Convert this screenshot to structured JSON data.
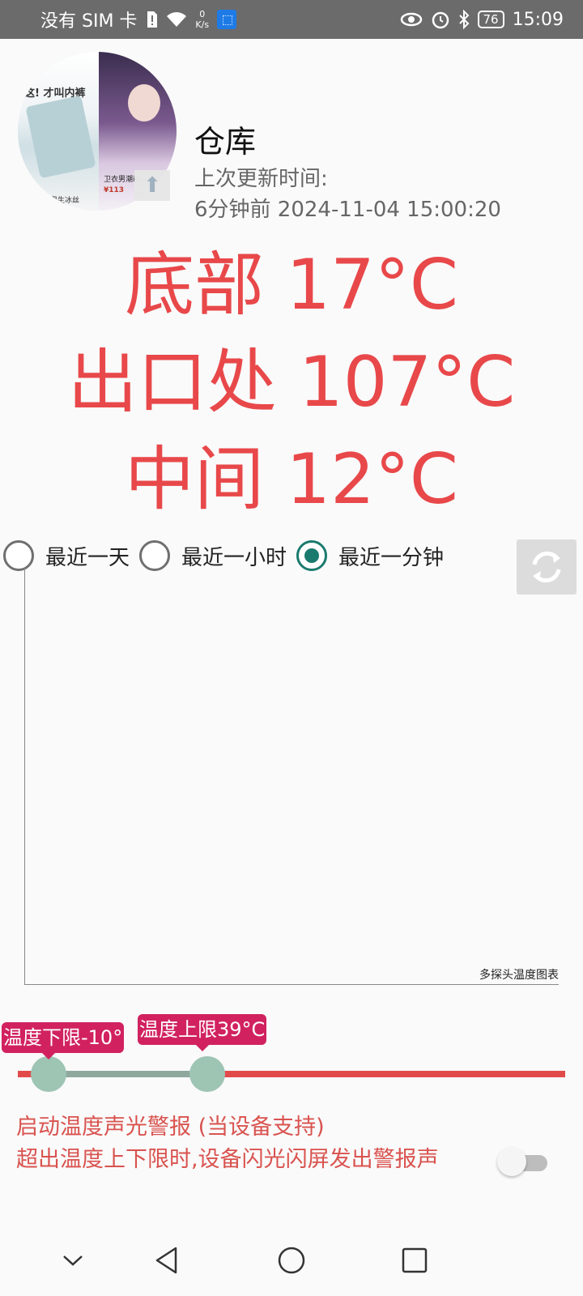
{
  "status_bar": {
    "carrier": "没有 SIM 卡",
    "speed_value": "0",
    "speed_unit": "K/s",
    "battery": "76",
    "time": "15:09",
    "icons": [
      "sim-alert-icon",
      "wifi-icon",
      "app-notification-icon",
      "eye-icon",
      "alarm-icon",
      "bluetooth-icon",
      "battery-icon"
    ]
  },
  "header": {
    "thumbnail": {
      "left_caption": "这! 才叫内裤",
      "left_footer": "男生冰丝",
      "right_caption": "卫衣男潮in",
      "right_price": "¥113"
    },
    "title": "仓库",
    "update_label": "上次更新时间:",
    "update_time": "6分钟前 2024-11-04 15:00:20"
  },
  "temperatures": [
    {
      "label": "底部 17°C"
    },
    {
      "label": "出口处 107°C"
    },
    {
      "label": "中间 12°C"
    }
  ],
  "temperature_color": "#e8484a",
  "range_options": [
    {
      "label": "最近一天",
      "checked": false
    },
    {
      "label": "最近一小时",
      "checked": false
    },
    {
      "label": "最近一分钟",
      "checked": true
    }
  ],
  "chart": {
    "description": "多探头温度图表"
  },
  "threshold": {
    "low_label": "温度下限-10°",
    "high_label": "温度上限39°C",
    "low_value": -10,
    "high_value": 39
  },
  "alarm": {
    "line1": "启动温度声光警报 (当设备支持)",
    "line2": "超出温度上下限时,设备闪光闪屏发出警报声",
    "enabled": false
  },
  "accent_color": "#d1225f"
}
